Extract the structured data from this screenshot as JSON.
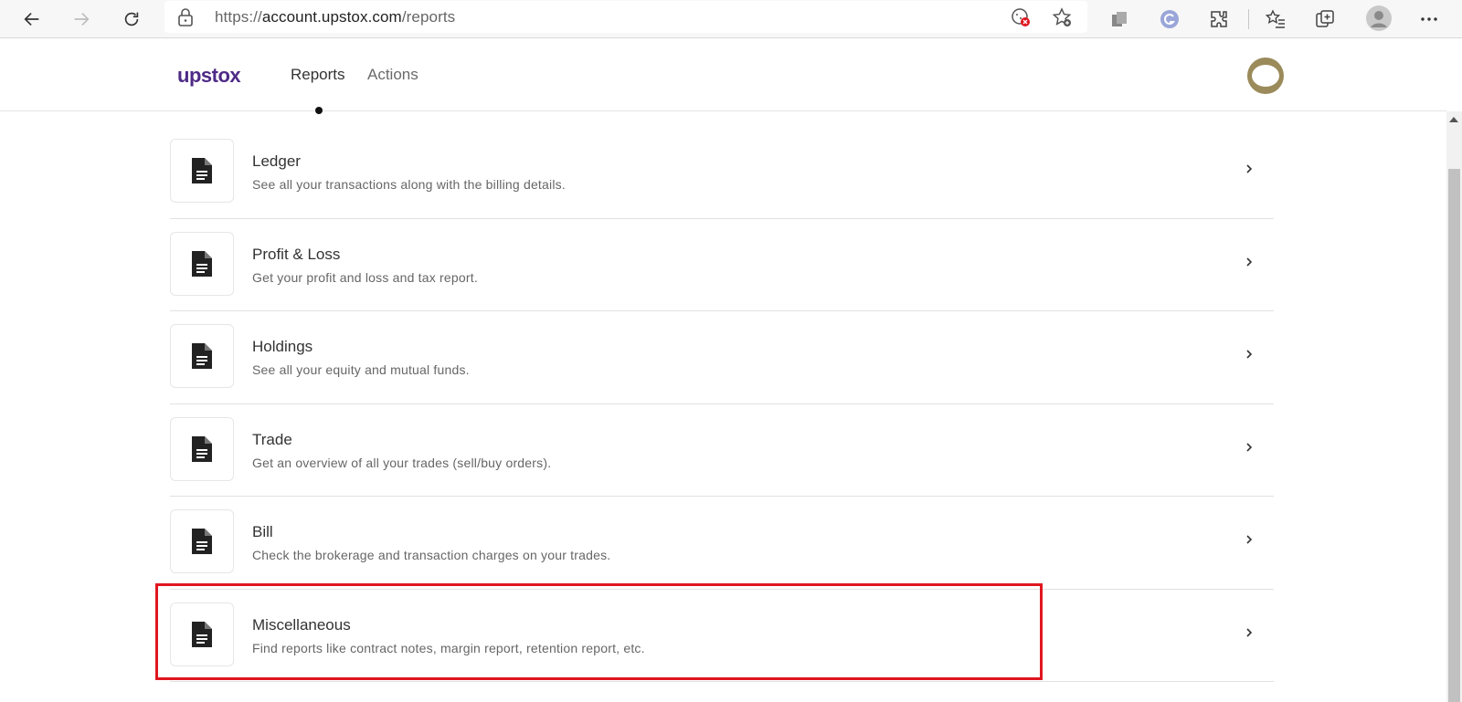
{
  "browser": {
    "url_prefix": "https://",
    "url_domain": "account.upstox.com",
    "url_path": "/reports"
  },
  "app": {
    "logo_text": "upstox",
    "nav": [
      {
        "label": "Reports",
        "active": true
      },
      {
        "label": "Actions",
        "active": false
      }
    ],
    "brand_color": "#4e2a86"
  },
  "reports": [
    {
      "title": "Ledger",
      "description": "See all your transactions along with the billing details."
    },
    {
      "title": "Profit & Loss",
      "description": "Get your profit and loss and tax report."
    },
    {
      "title": "Holdings",
      "description": "See all your equity and mutual funds."
    },
    {
      "title": "Trade",
      "description": "Get an overview of all your trades (sell/buy orders)."
    },
    {
      "title": "Bill",
      "description": "Check the brokerage and transaction charges on your trades."
    },
    {
      "title": "Miscellaneous",
      "description": "Find reports like contract notes, margin report, retention report, etc."
    }
  ],
  "icons": {
    "report_row": "document-icon",
    "row_arrow": "chevron-right-icon"
  },
  "highlight_color": "#e0161f"
}
